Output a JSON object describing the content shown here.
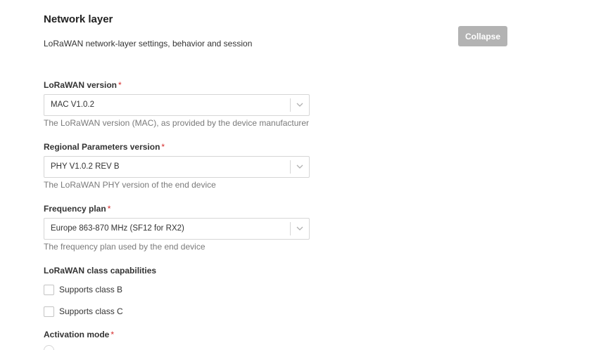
{
  "section": {
    "title": "Network layer",
    "subtitle": "LoRaWAN network-layer settings, behavior and session",
    "collapse_label": "Collapse"
  },
  "fields": {
    "lorawan_version": {
      "label": "LoRaWAN version",
      "required_mark": "*",
      "value": "MAC V1.0.2",
      "hint": "The LoRaWAN version (MAC), as provided by the device manufacturer"
    },
    "regional_parameters": {
      "label": "Regional Parameters version",
      "required_mark": "*",
      "value": "PHY V1.0.2 REV B",
      "hint": "The LoRaWAN PHY version of the end device"
    },
    "frequency_plan": {
      "label": "Frequency plan",
      "required_mark": "*",
      "value": "Europe 863-870 MHz (SF12 for RX2)",
      "hint": "The frequency plan used by the end device"
    },
    "class_capabilities": {
      "label": "LoRaWAN class capabilities",
      "options": [
        {
          "label": "Supports class B",
          "checked": false
        },
        {
          "label": "Supports class C",
          "checked": false
        }
      ]
    },
    "activation_mode": {
      "label": "Activation mode",
      "required_mark": "*"
    }
  },
  "icons": {
    "select_chevron": "chevron-down-icon"
  },
  "colors": {
    "required": "#d62a2a",
    "button_bg": "#b3b3b3",
    "hint_text": "#7a7a7a",
    "border": "#d6d6d6"
  }
}
